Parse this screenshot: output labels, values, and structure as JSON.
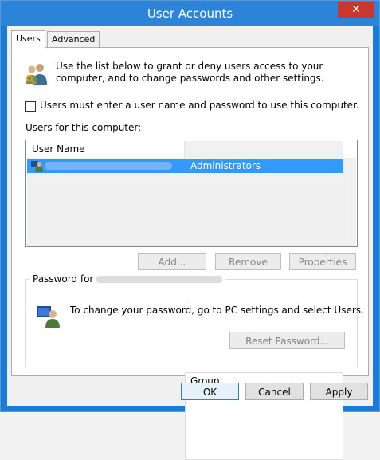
{
  "window": {
    "title": "User Accounts",
    "close_glyph": "✕"
  },
  "tabs": [
    {
      "label": "Users"
    },
    {
      "label": "Advanced"
    }
  ],
  "info": {
    "text": "Use the list below to grant or deny users access to your computer, and to change passwords and other settings."
  },
  "checkbox": {
    "label": "Users must enter a user name and password to use this computer.",
    "checked": false
  },
  "list": {
    "caption": "Users for this computer:",
    "columns": [
      "User Name",
      "Group"
    ],
    "rows": [
      {
        "user_name": "",
        "group": "Administrators",
        "selected": true
      }
    ]
  },
  "list_buttons": {
    "add": "Add...",
    "remove": "Remove",
    "properties": "Properties"
  },
  "password": {
    "group_label": "Password for",
    "text": "To change your password, go to PC settings and select Users.",
    "reset_button": "Reset Password..."
  },
  "dialog_buttons": {
    "ok": "OK",
    "cancel": "Cancel",
    "apply": "Apply"
  },
  "colors": {
    "titlebar": "#2c84d8",
    "selection": "#3399ff",
    "close": "#c8382f"
  }
}
